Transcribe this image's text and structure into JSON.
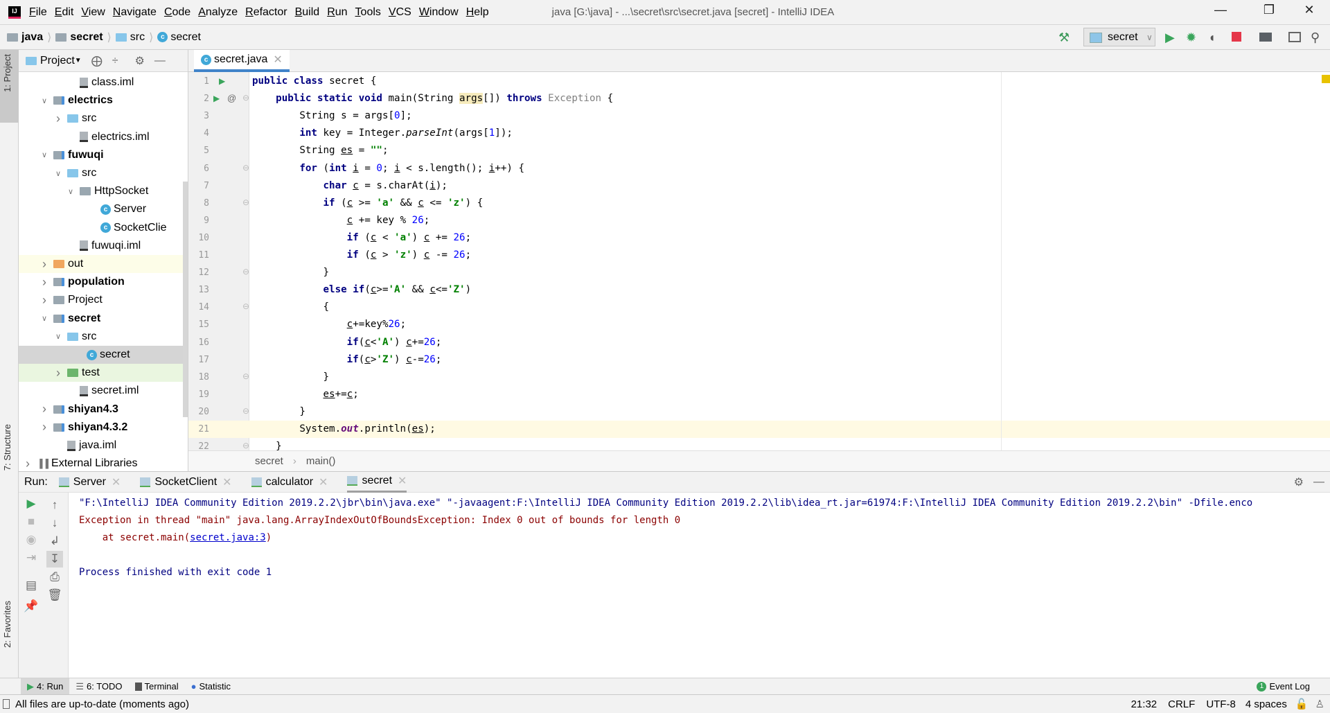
{
  "window": {
    "title": "java [G:\\java] - ...\\secret\\src\\secret.java [secret] - IntelliJ IDEA",
    "minimize_icon": "minimize-icon",
    "restore_icon": "restore-icon",
    "close_icon": "close-icon"
  },
  "menu": [
    "File",
    "Edit",
    "View",
    "Navigate",
    "Code",
    "Analyze",
    "Refactor",
    "Build",
    "Run",
    "Tools",
    "VCS",
    "Window",
    "Help"
  ],
  "navbar": {
    "crumbs": [
      "java",
      "secret",
      "src",
      "secret"
    ]
  },
  "toolbar": {
    "run_config": "secret"
  },
  "left_stripe": {
    "project": "1: Project",
    "structure": "7: Structure",
    "favorites": "2: Favorites"
  },
  "project_panel": {
    "title": "Project",
    "tree": [
      {
        "label": "class.iml",
        "level": 3,
        "type": "iml"
      },
      {
        "label": "electrics",
        "level": 1,
        "type": "module",
        "state": "open",
        "bold": true
      },
      {
        "label": "src",
        "level": 2,
        "type": "src",
        "state": "closed"
      },
      {
        "label": "electrics.iml",
        "level": 3,
        "type": "iml"
      },
      {
        "label": "fuwuqi",
        "level": 1,
        "type": "module",
        "state": "open",
        "bold": true
      },
      {
        "label": "src",
        "level": 2,
        "type": "src",
        "state": "open"
      },
      {
        "label": "HttpSocket",
        "level": 3,
        "type": "folder",
        "state": "open"
      },
      {
        "label": "Server",
        "level": 5,
        "type": "class"
      },
      {
        "label": "SocketClie",
        "level": 5,
        "type": "class"
      },
      {
        "label": "fuwuqi.iml",
        "level": 3,
        "type": "iml"
      },
      {
        "label": "out",
        "level": 1,
        "type": "out",
        "state": "closed",
        "bg": "#fdfde8"
      },
      {
        "label": "population",
        "level": 1,
        "type": "module",
        "state": "closed",
        "bold": true
      },
      {
        "label": "Project",
        "level": 1,
        "type": "folder",
        "state": "closed"
      },
      {
        "label": "secret",
        "level": 1,
        "type": "module",
        "state": "open",
        "bold": true
      },
      {
        "label": "src",
        "level": 2,
        "type": "src",
        "state": "open"
      },
      {
        "label": "secret",
        "level": 4,
        "type": "class",
        "selected": true
      },
      {
        "label": "test",
        "level": 2,
        "type": "test",
        "state": "closed",
        "bg": "#eaf6e0"
      },
      {
        "label": "secret.iml",
        "level": 3,
        "type": "iml"
      },
      {
        "label": "shiyan4.3",
        "level": 1,
        "type": "module",
        "state": "closed",
        "bold": true
      },
      {
        "label": "shiyan4.3.2",
        "level": 1,
        "type": "module",
        "state": "closed",
        "bold": true
      },
      {
        "label": "java.iml",
        "level": 2,
        "type": "iml"
      },
      {
        "label": "External Libraries",
        "level": 0,
        "type": "lib",
        "state": "closed"
      }
    ]
  },
  "editor": {
    "tab": "secret.java",
    "current_line": 21,
    "lines": [
      "public class secret {",
      "    public static void main(String args[]) throws Exception {",
      "        String s = args[0];",
      "        int key = Integer.parseInt(args[1]);",
      "        String es = \"\";",
      "        for (int i = 0; i < s.length(); i++) {",
      "            char c = s.charAt(i);",
      "            if (c >= 'a' && c <= 'z') {",
      "                c += key % 26;",
      "                if (c < 'a') c += 26;",
      "                if (c > 'z') c -= 26;",
      "            }",
      "            else if(c>='A' && c<='Z')",
      "            {",
      "                c+=key%26;",
      "                if(c<'A') c+=26;",
      "                if(c>'Z') c-=26;",
      "            }",
      "            es+=c;",
      "        }",
      "        System.out.println(es);",
      "    }"
    ],
    "breadcrumb": [
      "secret",
      "main()"
    ]
  },
  "run_panel": {
    "label": "Run:",
    "tabs": [
      {
        "label": "Server"
      },
      {
        "label": "SocketClient"
      },
      {
        "label": "calculator"
      },
      {
        "label": "secret",
        "active": true
      }
    ],
    "console": {
      "cmd": "\"F:\\IntelliJ IDEA Community Edition 2019.2.2\\jbr\\bin\\java.exe\" \"-javaagent:F:\\IntelliJ IDEA Community Edition 2019.2.2\\lib\\idea_rt.jar=61974:F:\\IntelliJ IDEA Community Edition 2019.2.2\\bin\" -Dfile.enco",
      "exception": "Exception in thread \"main\" java.lang.ArrayIndexOutOfBoundsException: Index 0 out of bounds for length 0",
      "at_prefix": "    at secret.main(",
      "at_link": "secret.java:3",
      "at_suffix": ")",
      "finished": "Process finished with exit code 1"
    }
  },
  "bottom_tools": [
    "4: Run",
    "6: TODO",
    "Terminal",
    "Statistic"
  ],
  "event_log": "Event Log",
  "status": {
    "message": "All files are up-to-date (moments ago)",
    "position": "21:32",
    "line_sep": "CRLF",
    "encoding": "UTF-8",
    "indent": "4 spaces"
  }
}
